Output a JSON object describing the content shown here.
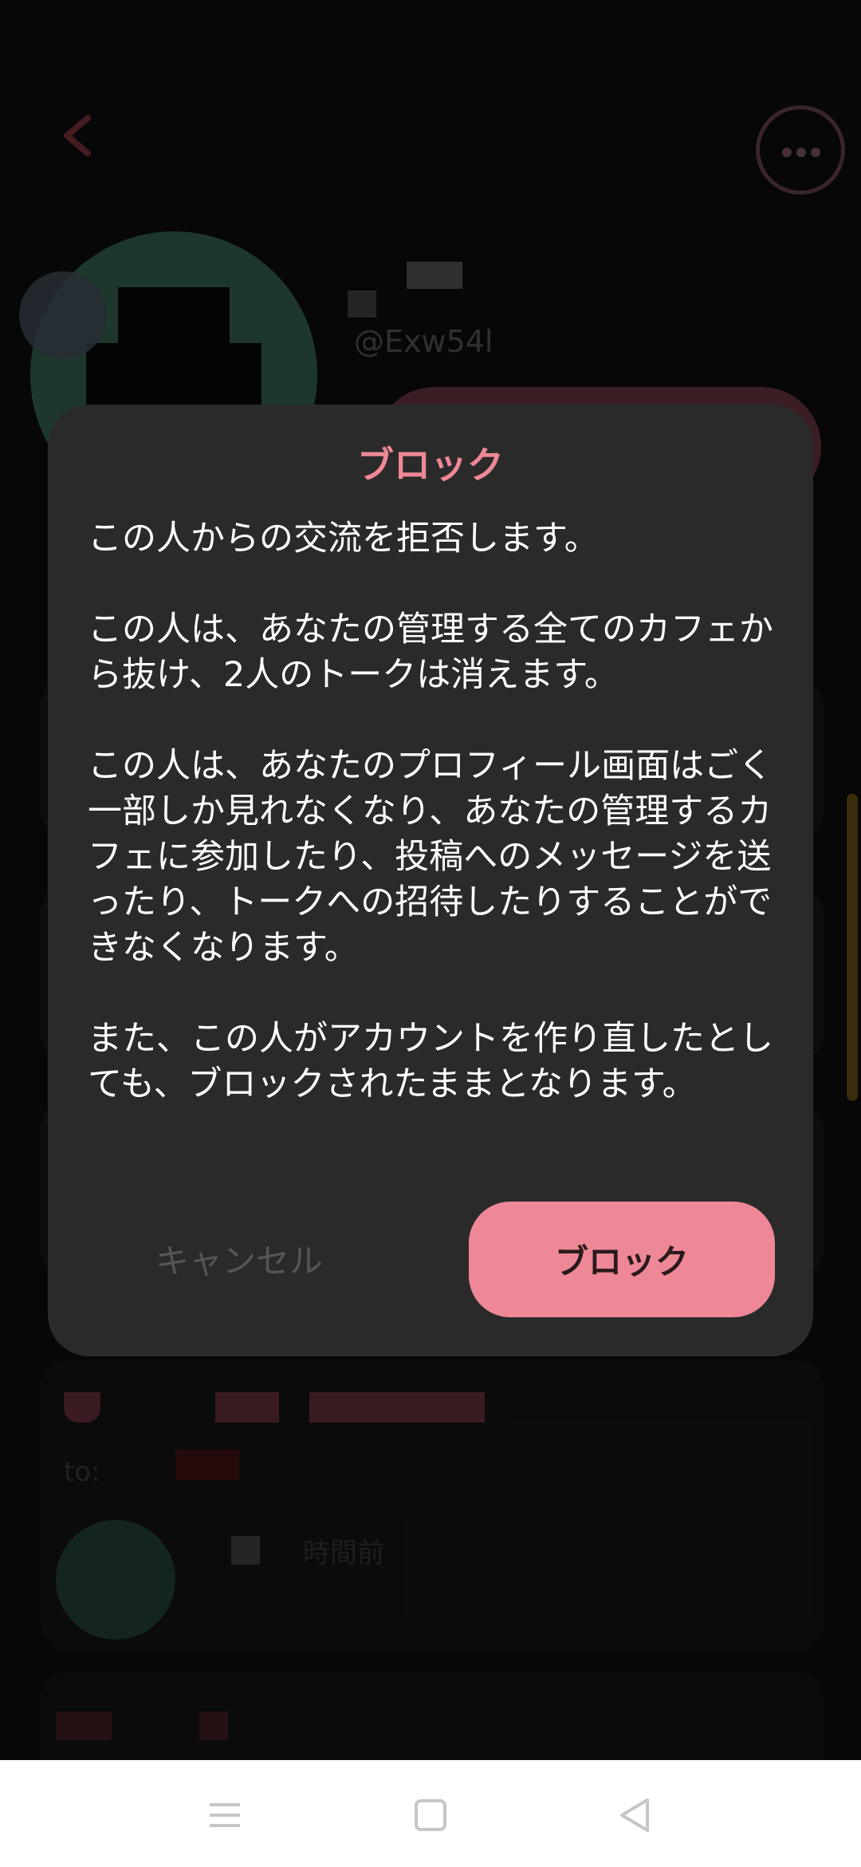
{
  "profile": {
    "handle": "@Exw54l"
  },
  "background_card": {
    "to_label": "to:",
    "time_suffix": "時間前"
  },
  "dialog": {
    "title": "ブロック",
    "paragraphs": [
      "この人からの交流を拒否します。",
      "この人は、あなたの管理する全てのカフェから抜け、2人のトークは消えます。",
      "この人は、あなたのプロフィール画面はごく一部しか見れなくなり、あなたの管理するカフェに参加したり、投稿へのメッセージを送ったり、トークへの招待したりすることができなくなります。",
      "また、この人がアカウントを作り直したとしても、ブロックされたままとなります。"
    ],
    "cancel_label": "キャンセル",
    "confirm_label": "ブロック"
  },
  "colors": {
    "accent_pink": "#ee8896",
    "dialog_bg": "#2b2a2b",
    "screen_bg": "#0b0b0b"
  },
  "navbar": {
    "icons": [
      "menu-icon",
      "home-square-icon",
      "back-triangle-icon"
    ]
  }
}
